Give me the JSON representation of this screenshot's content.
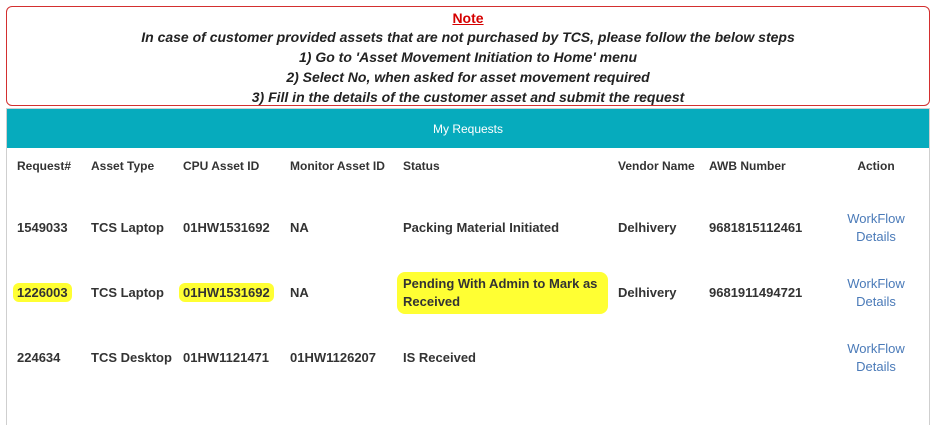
{
  "note": {
    "title": "Note",
    "lines": [
      "In case of customer provided assets that are not purchased by TCS, please follow the below steps",
      "1) Go to 'Asset Movement Initiation to Home' menu",
      "2) Select No, when asked for asset movement required",
      "3) Fill in the details of the customer asset and submit the request"
    ]
  },
  "panel": {
    "title": "My Requests"
  },
  "table": {
    "headers": {
      "request": "Request#",
      "asset_type": "Asset Type",
      "cpu_asset_id": "CPU Asset ID",
      "monitor_asset_id": "Monitor Asset ID",
      "status": "Status",
      "vendor": "Vendor Name",
      "awb": "AWB Number",
      "action": "Action"
    },
    "rows": [
      {
        "request": "1549033",
        "asset_type": "TCS Laptop",
        "cpu_asset_id": "01HW1531692",
        "monitor_asset_id": "NA",
        "status": "Packing Material Initiated",
        "vendor": "Delhivery",
        "awb": "9681815112461",
        "action_line1": "WorkFlow",
        "action_line2": "Details"
      },
      {
        "request": "1226003",
        "asset_type": "TCS Laptop",
        "cpu_asset_id": "01HW1531692",
        "monitor_asset_id": "NA",
        "status": "Pending With Admin to Mark as Received",
        "vendor": "Delhivery",
        "awb": "9681911494721",
        "action_line1": "WorkFlow",
        "action_line2": "Details"
      },
      {
        "request": "224634",
        "asset_type": "TCS Desktop",
        "cpu_asset_id": "01HW1121471",
        "monitor_asset_id": "01HW1126207",
        "status": "IS Received",
        "vendor": "",
        "awb": "",
        "action_line1": "WorkFlow",
        "action_line2": "Details"
      }
    ]
  },
  "colors": {
    "header_bg": "#06abbd",
    "highlight": "#ffff33",
    "note_border": "#d32f2f",
    "note_title": "#d50000",
    "link": "#4a7ab8"
  }
}
